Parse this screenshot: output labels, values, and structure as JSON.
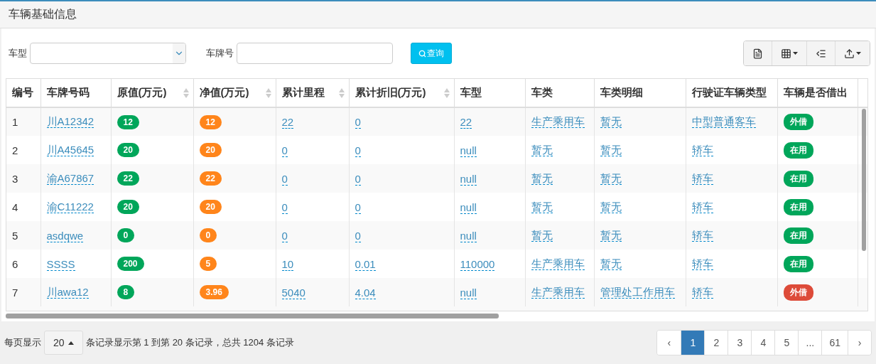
{
  "panel": {
    "title": "车辆基础信息"
  },
  "filters": {
    "model_label": "车型",
    "plate_label": "车牌号",
    "search_button": "查询"
  },
  "table": {
    "columns": [
      {
        "label": "编号",
        "sortable": false
      },
      {
        "label": "车牌号码",
        "sortable": false
      },
      {
        "label": "原值(万元)",
        "sortable": true
      },
      {
        "label": "净值(万元)",
        "sortable": true
      },
      {
        "label": "累计里程",
        "sortable": true
      },
      {
        "label": "累计折旧(万元)",
        "sortable": true
      },
      {
        "label": "车型",
        "sortable": false
      },
      {
        "label": "车类",
        "sortable": false
      },
      {
        "label": "车类明细",
        "sortable": false
      },
      {
        "label": "行驶证车辆类型",
        "sortable": false
      },
      {
        "label": "车辆是否借出",
        "sortable": false
      }
    ],
    "rows": [
      {
        "no": "1",
        "plate": "川A12342",
        "original": {
          "text": "12",
          "color": "#00a65a"
        },
        "net": {
          "text": "12",
          "color": "#ff851b"
        },
        "mileage": "22",
        "depreciation": "0",
        "model": "22",
        "category": "生产乘用车",
        "category_detail": "暂无",
        "license_type": "中型普通客车",
        "status": {
          "text": "外借",
          "color": "#00a65a"
        }
      },
      {
        "no": "2",
        "plate": "川A45645",
        "original": {
          "text": "20",
          "color": "#00a65a"
        },
        "net": {
          "text": "20",
          "color": "#ff851b"
        },
        "mileage": "0",
        "depreciation": "0",
        "model": "null",
        "category": "暂无",
        "category_detail": "暂无",
        "license_type": "轿车",
        "status": {
          "text": "在用",
          "color": "#00a65a"
        }
      },
      {
        "no": "3",
        "plate": "渝A67867",
        "original": {
          "text": "22",
          "color": "#00a65a"
        },
        "net": {
          "text": "22",
          "color": "#ff851b"
        },
        "mileage": "0",
        "depreciation": "0",
        "model": "null",
        "category": "暂无",
        "category_detail": "暂无",
        "license_type": "轿车",
        "status": {
          "text": "在用",
          "color": "#00a65a"
        }
      },
      {
        "no": "4",
        "plate": "渝C11222",
        "original": {
          "text": "20",
          "color": "#00a65a"
        },
        "net": {
          "text": "20",
          "color": "#ff851b"
        },
        "mileage": "0",
        "depreciation": "0",
        "model": "null",
        "category": "暂无",
        "category_detail": "暂无",
        "license_type": "轿车",
        "status": {
          "text": "在用",
          "color": "#00a65a"
        }
      },
      {
        "no": "5",
        "plate": "asdqwe",
        "original": {
          "text": "0",
          "color": "#00a65a"
        },
        "net": {
          "text": "0",
          "color": "#ff851b"
        },
        "mileage": "0",
        "depreciation": "0",
        "model": "null",
        "category": "暂无",
        "category_detail": "暂无",
        "license_type": "轿车",
        "status": {
          "text": "在用",
          "color": "#00a65a"
        }
      },
      {
        "no": "6",
        "plate": "SSSS",
        "original": {
          "text": "200",
          "color": "#00a65a"
        },
        "net": {
          "text": "5",
          "color": "#ff851b"
        },
        "mileage": "10",
        "depreciation": "0.01",
        "model": "110000",
        "category": "生产乘用车",
        "category_detail": "暂无",
        "license_type": "轿车",
        "status": {
          "text": "在用",
          "color": "#00a65a"
        }
      },
      {
        "no": "7",
        "plate": "川awa12",
        "original": {
          "text": "8",
          "color": "#00a65a"
        },
        "net": {
          "text": "3.96",
          "color": "#ff851b"
        },
        "mileage": "5040",
        "depreciation": "4.04",
        "model": "null",
        "category": "生产乘用车",
        "category_detail": "管理处工作用车",
        "license_type": "轿车",
        "status": {
          "text": "外借",
          "color": "#dd4b39"
        }
      }
    ]
  },
  "footer": {
    "per_page_label": "每页显示",
    "per_page": "20",
    "summary": "条记录显示第 1 到第 20 条记录，总共 1204 条记录",
    "prev": "‹",
    "next": "›",
    "pages": [
      {
        "label": "1",
        "selected": true
      },
      {
        "label": "2",
        "selected": false
      },
      {
        "label": "3",
        "selected": false
      },
      {
        "label": "4",
        "selected": false
      },
      {
        "label": "5",
        "selected": false
      },
      {
        "label": "...",
        "selected": false
      },
      {
        "label": "61",
        "selected": false
      }
    ]
  }
}
